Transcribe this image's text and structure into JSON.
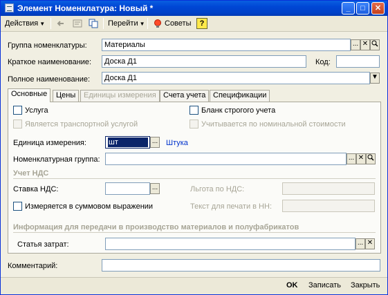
{
  "window": {
    "title": "Элемент Номенклатура: Новый *",
    "controls": {
      "minimize": "_",
      "maximize": "□",
      "close": "✕"
    }
  },
  "toolbar": {
    "actions_label": "Действия",
    "goto_label": "Перейти",
    "tips_label": "Советы",
    "help_label": "?"
  },
  "form": {
    "group_label": "Группа номенклатуры:",
    "group_value": "Материалы",
    "short_name_label": "Краткое наименование:",
    "short_name_value": "Доска Д1",
    "code_label": "Код:",
    "code_value": "",
    "full_name_label": "Полное наименование:",
    "full_name_value": "Доска Д1",
    "comment_label": "Комментарий:",
    "comment_value": ""
  },
  "tabs": [
    {
      "label": "Основные",
      "active": true
    },
    {
      "label": "Цены",
      "active": false
    },
    {
      "label": "Единицы измерения",
      "active": false,
      "disabled": true
    },
    {
      "label": "Счета учета",
      "active": false
    },
    {
      "label": "Спецификации",
      "active": false
    }
  ],
  "main": {
    "service_label": "Услуга",
    "strict_form_label": "Бланк строгого учета",
    "transport_label": "Является транспортной услугой",
    "nominal_label": "Учитывается по номинальной стоимости",
    "unit_label": "Единица измерения:",
    "unit_value": "шт",
    "unit_name": "Штука",
    "nomenclature_group_label": "Номенклатурная группа:",
    "nomenclature_group_value": "",
    "vat_section": "Учет НДС",
    "vat_rate_label": "Ставка НДС:",
    "vat_rate_value": "",
    "vat_benefit_label": "Льгота по НДС:",
    "vat_benefit_value": "",
    "sum_measure_label": "Измеряется в суммовом выражении",
    "print_text_label": "Текст для печати в НН:",
    "print_text_value": "",
    "production_section": "Информация для передачи в производство материалов и полуфабрикатов",
    "cost_item_label": "Статья затрат:",
    "cost_item_value": ""
  },
  "buttons": {
    "ok": "OK",
    "save": "Записать",
    "close": "Закрыть"
  },
  "colors": {
    "title_bar": "#0046d5",
    "link": "#0033cc",
    "selection": "#0a246a"
  }
}
